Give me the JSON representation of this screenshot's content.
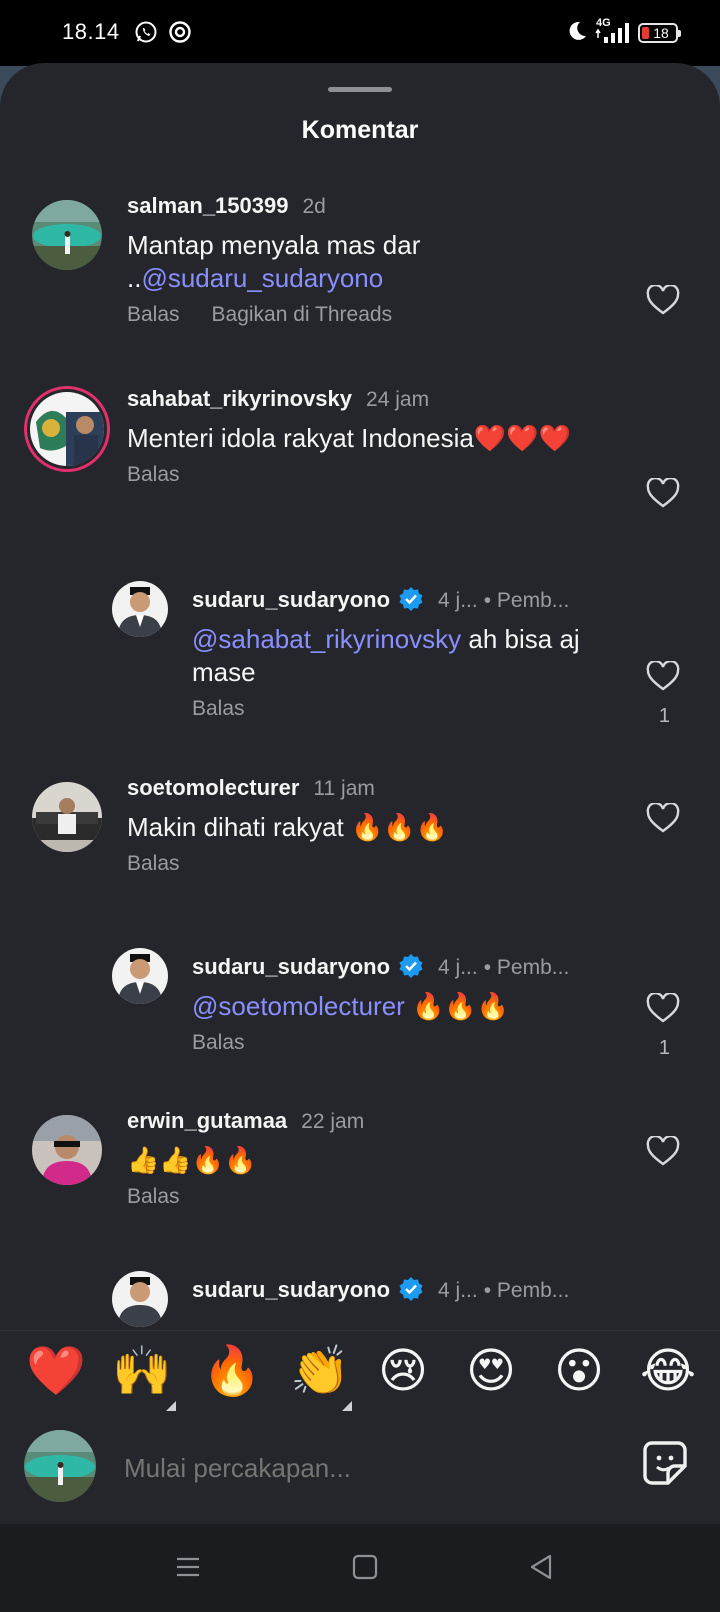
{
  "status_bar": {
    "time": "18.14",
    "network": "4G",
    "battery": "18",
    "icons": [
      "whatsapp-icon",
      "chrome-icon",
      "moon-icon",
      "signal-icon",
      "battery-icon"
    ]
  },
  "sheet": {
    "title": "Komentar"
  },
  "comments": [
    {
      "username": "salman_150399",
      "time": "2d",
      "text_before": "Mantap menyala mas dar ..",
      "mention": "@sudaru_sudaryono",
      "text_after": "",
      "actions": [
        "Balas",
        "Bagikan di Threads"
      ]
    },
    {
      "username": "sahabat_rikyrinovsky",
      "time": "24 jam",
      "text_before": "Menteri idola rakyat Indonesia❤️❤️❤️",
      "mention": "",
      "text_after": "",
      "actions": [
        "Balas"
      ]
    },
    {
      "username": "sudaru_sudaryono",
      "time": "4 j...",
      "author_tag": "• Pemb...",
      "text_before": "",
      "mention": "@sahabat_rikyrinovsky",
      "text_after": " ah bisa aj mase",
      "actions": [
        "Balas"
      ],
      "likes": "1"
    },
    {
      "username": "soetomolecturer",
      "time": "11 jam",
      "text_before": "Makin dihati rakyat 🔥🔥🔥",
      "mention": "",
      "text_after": "",
      "actions": [
        "Balas"
      ]
    },
    {
      "username": "sudaru_sudaryono",
      "time": "4 j...",
      "author_tag": "• Pemb...",
      "text_before": "",
      "mention": "@soetomolecturer",
      "text_after": " 🔥🔥🔥",
      "actions": [
        "Balas"
      ],
      "likes": "1"
    },
    {
      "username": "erwin_gutamaa",
      "time": "22 jam",
      "text_before": "👍👍🔥🔥",
      "mention": "",
      "text_after": "",
      "actions": [
        "Balas"
      ]
    },
    {
      "username": "sudaru_sudaryono",
      "time": "4 j...",
      "author_tag": "• Pemb..."
    }
  ],
  "emoji_bar": [
    "❤️",
    "🙌",
    "🔥",
    "👏",
    "😢",
    "😍",
    "😮",
    "😂"
  ],
  "composer": {
    "placeholder": "Mulai percakapan..."
  },
  "colors": {
    "sheet_bg": "#24262b",
    "mention": "#8a8fff",
    "verified": "#1d9bf0",
    "muted_text": "#9a9ca1"
  }
}
